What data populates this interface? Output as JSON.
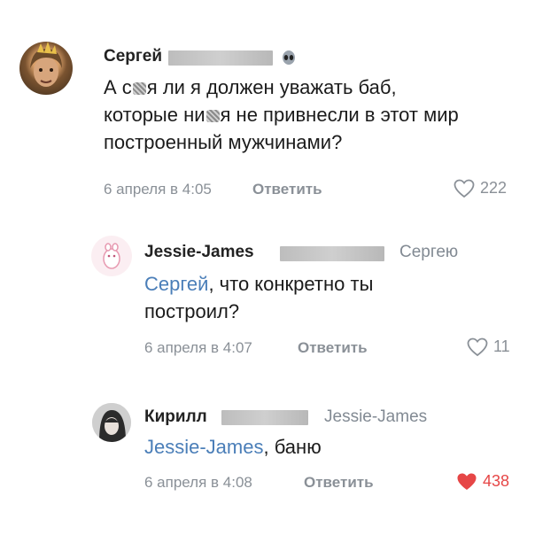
{
  "comments": [
    {
      "author": "Сергей",
      "text_lines": [
        [
          "А с",
          "я ли я должен уважать баб,"
        ],
        [
          "которые ни",
          "я не привнесли в этот мир"
        ],
        [
          "построенный мужчинами?"
        ]
      ],
      "date": "6 апреля в 4:05",
      "reply_label": "Ответить",
      "likes": "222",
      "liked": false,
      "badge_icon": "alien-icon"
    },
    {
      "author": "Jessie-James",
      "reply_to": "Сергею",
      "mention": "Сергей",
      "text_rest_line1": ", что конкретно ты",
      "text_line2": "построил?",
      "date": "6 апреля в 4:07",
      "reply_label": "Ответить",
      "likes": "11",
      "liked": false
    },
    {
      "author": "Кирилл",
      "reply_to": "Jessie-James",
      "mention": "Jessie-James",
      "text_rest_line1": ", баню",
      "date": "6 апреля в 4:08",
      "reply_label": "Ответить",
      "likes": "438",
      "liked": true,
      "like_color": "#e64646"
    }
  ]
}
